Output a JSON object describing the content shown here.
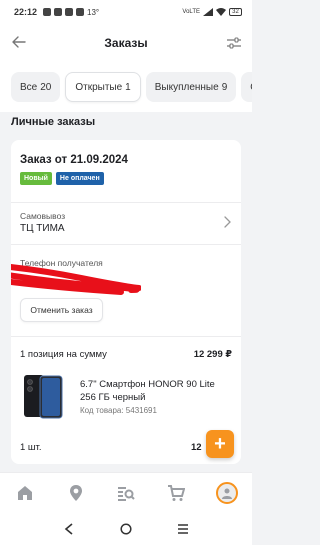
{
  "status_bar": {
    "time": "22:12",
    "temperature": "13°",
    "battery": "32",
    "network": "VoLTE"
  },
  "header": {
    "title": "Заказы",
    "back_icon": "arrow-left-icon",
    "filter_icon": "sliders-icon"
  },
  "tabs": [
    {
      "label": "Все",
      "count": "20",
      "active": false
    },
    {
      "label": "Открытые",
      "count": "1",
      "active": true
    },
    {
      "label": "Выкупленные",
      "count": "9",
      "active": false
    },
    {
      "label": "О",
      "count": "",
      "active": false
    }
  ],
  "section_title": "Личные заказы",
  "order": {
    "title": "Заказ от 21.09.2024",
    "badges": [
      {
        "label": "Новый",
        "color": "#66bb3c"
      },
      {
        "label": "Не оплачен",
        "color": "#1f62a9"
      }
    ],
    "pickup_label": "Самовывоз",
    "pickup_value": "ТЦ ТИМА",
    "phone_label": "Телефон получателя",
    "cancel_label": "Отменить заказ",
    "summary_label": "1 позиция на сумму",
    "summary_value": "12 299 ₽",
    "product": {
      "name": "6.7\" Смартфон HONOR 90 Lite 256 ГБ черный",
      "code": "Код товара: 5431691",
      "qty": "1 шт.",
      "price_visible": "12"
    }
  },
  "fab_label": "+",
  "bottom_nav": [
    {
      "icon": "home-icon"
    },
    {
      "icon": "location-pin-icon"
    },
    {
      "icon": "catalog-search-icon"
    },
    {
      "icon": "cart-icon"
    },
    {
      "icon": "profile-avatar-icon"
    }
  ],
  "accent_color": "#f7931e"
}
